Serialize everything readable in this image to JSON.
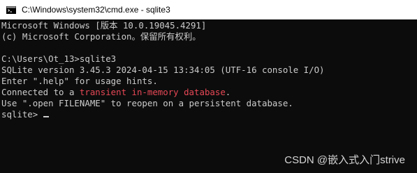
{
  "window": {
    "title": "C:\\Windows\\system32\\cmd.exe - sqlite3",
    "icon": "cmd-icon"
  },
  "console": {
    "lines": [
      {
        "text": "Microsoft Windows [版本 10.0.19045.4291]"
      },
      {
        "text": "(c) Microsoft Corporation。保留所有权利。"
      },
      {
        "text": ""
      },
      {
        "text": "C:\\Users\\Ot_13>sqlite3"
      },
      {
        "text": "SQLite version 3.45.3 2024-04-15 13:34:05 (UTF-16 console I/O)"
      },
      {
        "text": "Enter \".help\" for usage hints."
      },
      {
        "prefix": "Connected to a ",
        "highlight": "transient in-memory database",
        "suffix": "."
      },
      {
        "text": "Use \".open FILENAME\" to reopen on a persistent database."
      },
      {
        "prompt": "sqlite> "
      }
    ],
    "colors": {
      "background": "#0c0c0c",
      "foreground": "#cccccc",
      "highlight": "#e74856"
    }
  },
  "watermark": {
    "text": "CSDN @嵌入式入门strive"
  }
}
